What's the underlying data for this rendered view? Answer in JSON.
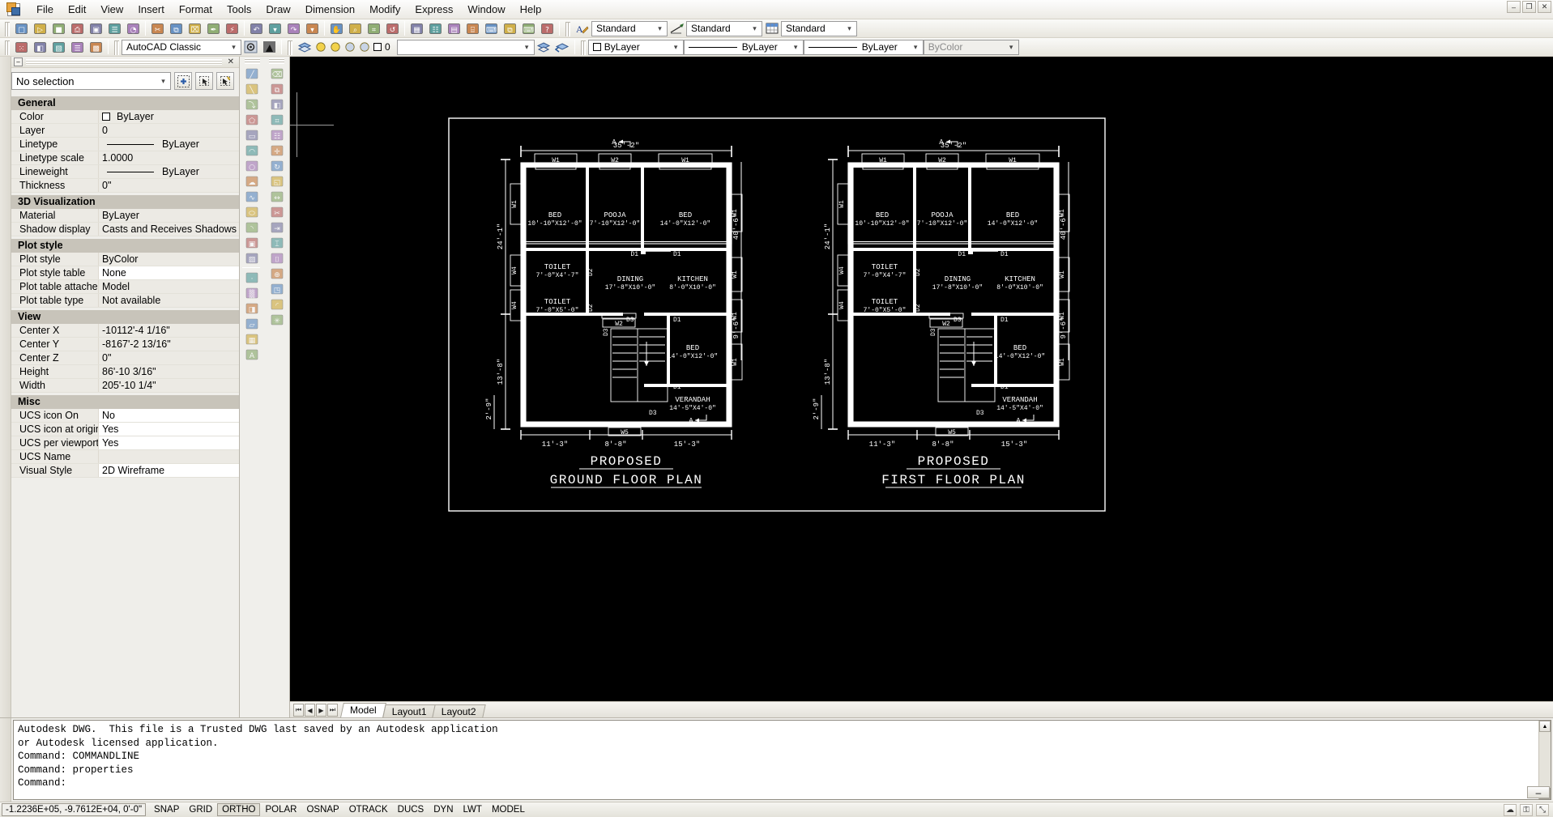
{
  "app": {
    "title": "AutoCAD Classic",
    "logo_icon": "autocad-logo-icon"
  },
  "menubar": {
    "items": [
      {
        "label": "File"
      },
      {
        "label": "Edit"
      },
      {
        "label": "View"
      },
      {
        "label": "Insert"
      },
      {
        "label": "Format"
      },
      {
        "label": "Tools"
      },
      {
        "label": "Draw"
      },
      {
        "label": "Dimension"
      },
      {
        "label": "Modify"
      },
      {
        "label": "Express"
      },
      {
        "label": "Window"
      },
      {
        "label": "Help"
      }
    ],
    "window_buttons": [
      {
        "name": "minimize-button",
        "glyph": "–"
      },
      {
        "name": "restore-button",
        "glyph": "❐"
      },
      {
        "name": "close-button",
        "glyph": "✕"
      }
    ]
  },
  "toolbar_row1": {
    "icons": [
      {
        "name": "new-icon",
        "glyph": "□"
      },
      {
        "name": "open-icon",
        "glyph": "▷"
      },
      {
        "name": "save-icon",
        "glyph": "■"
      },
      {
        "name": "plot-icon",
        "glyph": "⎙"
      },
      {
        "name": "plot-preview-icon",
        "glyph": "▣"
      },
      {
        "name": "publish-icon",
        "glyph": "☰"
      },
      {
        "name": "publish-to-web-icon",
        "glyph": "◔"
      },
      {
        "name": "cut-icon",
        "glyph": "✂"
      },
      {
        "name": "copy-icon",
        "glyph": "⧉"
      },
      {
        "name": "paste-icon",
        "glyph": "⌧"
      },
      {
        "name": "match-properties-icon",
        "glyph": "✒"
      },
      {
        "name": "block-editor-icon",
        "glyph": "⚡"
      },
      {
        "name": "undo-icon",
        "glyph": "↶"
      },
      {
        "name": "undo-dropdown-icon",
        "glyph": "▾"
      },
      {
        "name": "redo-icon",
        "glyph": "↷"
      },
      {
        "name": "redo-dropdown-icon",
        "glyph": "▾"
      },
      {
        "name": "pan-realtime-icon",
        "glyph": "✋"
      },
      {
        "name": "zoom-realtime-icon",
        "glyph": "⌕"
      },
      {
        "name": "zoom-window-icon",
        "glyph": "⌗"
      },
      {
        "name": "zoom-previous-icon",
        "glyph": "↺"
      },
      {
        "name": "properties-icon",
        "glyph": "▦"
      },
      {
        "name": "designcenter-icon",
        "glyph": "☷"
      },
      {
        "name": "tool-palettes-icon",
        "glyph": "▤"
      },
      {
        "name": "sheet-set-manager-icon",
        "glyph": "⌸"
      },
      {
        "name": "markup-set-manager-icon",
        "glyph": "⌨"
      },
      {
        "name": "external-references-icon",
        "glyph": "⧉"
      },
      {
        "name": "quickcalc-icon",
        "glyph": "⌨"
      },
      {
        "name": "help-icon",
        "glyph": "?"
      }
    ],
    "text_style": {
      "label": "Standard",
      "icon": "text-style-icon"
    },
    "dim_style": {
      "label": "Standard",
      "icon": "dimension-style-icon"
    },
    "table_style": {
      "label": "Standard",
      "icon": "table-style-icon"
    }
  },
  "toolbar_row2": {
    "icons": [
      {
        "name": "point-style-icon",
        "glyph": "⁙"
      },
      {
        "name": "layer-previous-icon",
        "glyph": "◧"
      },
      {
        "name": "layer-states-icon",
        "glyph": "▧"
      },
      {
        "name": "standards-icon",
        "glyph": "☰"
      },
      {
        "name": "layer-translator-icon",
        "glyph": "▩"
      }
    ],
    "workspace": {
      "label": "AutoCAD Classic"
    },
    "workspace_settings_icon": "workspace-settings-icon",
    "workspace_lock_icon": "workspace-lock-icon",
    "layer_properties_icon": "layer-properties-manager-icon",
    "layer_status_icons": [
      {
        "name": "layer-on-icon",
        "glyph": "○"
      },
      {
        "name": "layer-freeze-icon",
        "glyph": "●"
      },
      {
        "name": "layer-freeze-vp-icon",
        "glyph": "⚙"
      },
      {
        "name": "layer-lock-icon",
        "glyph": "⚿"
      }
    ],
    "current_layer": "0",
    "layer_color_swatch": "#ffffff",
    "make_object_layer_icon": "make-object-layer-current-icon",
    "layer_previous_icon": "layer-previous-icon",
    "color_control": {
      "label": "ByLayer",
      "swatch": "#ffffff"
    },
    "linetype_control": {
      "label": "ByLayer"
    },
    "lineweight_control": {
      "label": "ByLayer"
    },
    "plotstyle_control": {
      "label": "ByColor",
      "disabled": true
    }
  },
  "properties_palette": {
    "title_min_glyph": "–",
    "close_glyph": "✕",
    "selection": "No selection",
    "quick_select_icon": "quick-select-icon",
    "toggle_pickadd_icon": "toggle-value-pickadd-icon",
    "select_objects_icon": "select-objects-icon",
    "groups": [
      {
        "header": "General",
        "rows": [
          {
            "name": "Color",
            "value": "ByLayer",
            "swatch": "#ffffff",
            "editable": false
          },
          {
            "name": "Layer",
            "value": "0",
            "editable": false
          },
          {
            "name": "Linetype",
            "value": "ByLayer",
            "line": true,
            "editable": false
          },
          {
            "name": "Linetype scale",
            "value": "1.0000",
            "editable": false
          },
          {
            "name": "Lineweight",
            "value": "ByLayer",
            "line": true,
            "editable": false
          },
          {
            "name": "Thickness",
            "value": "0\"",
            "editable": false
          }
        ]
      },
      {
        "header": "3D Visualization",
        "rows": [
          {
            "name": "Material",
            "value": "ByLayer",
            "editable": false
          },
          {
            "name": "Shadow display",
            "value": "Casts and Receives Shadows",
            "editable": false
          }
        ]
      },
      {
        "header": "Plot style",
        "rows": [
          {
            "name": "Plot style",
            "value": "ByColor",
            "editable": false
          },
          {
            "name": "Plot style table",
            "value": "None",
            "editable": true
          },
          {
            "name": "Plot table attache...",
            "value": "Model",
            "editable": false
          },
          {
            "name": "Plot table type",
            "value": "Not available",
            "editable": false
          }
        ]
      },
      {
        "header": "View",
        "rows": [
          {
            "name": "Center X",
            "value": "-10112'-4 1/16\"",
            "editable": false
          },
          {
            "name": "Center Y",
            "value": "-8167'-2 13/16\"",
            "editable": false
          },
          {
            "name": "Center Z",
            "value": "0\"",
            "editable": false
          },
          {
            "name": "Height",
            "value": "86'-10 3/16\"",
            "editable": false
          },
          {
            "name": "Width",
            "value": "205'-10 1/4\"",
            "editable": false
          }
        ]
      },
      {
        "header": "Misc",
        "rows": [
          {
            "name": "UCS icon On",
            "value": "No",
            "editable": true
          },
          {
            "name": "UCS icon at origin",
            "value": "Yes",
            "editable": true
          },
          {
            "name": "UCS per viewport",
            "value": "Yes",
            "editable": true
          },
          {
            "name": "UCS Name",
            "value": "",
            "editable": false
          },
          {
            "name": "Visual Style",
            "value": "2D Wireframe",
            "editable": true
          }
        ]
      }
    ]
  },
  "draw_toolbar": {
    "icons": [
      {
        "name": "line-icon",
        "glyph": "╱"
      },
      {
        "name": "construction-line-icon",
        "glyph": "╲"
      },
      {
        "name": "polyline-icon",
        "glyph": "⤵"
      },
      {
        "name": "polygon-icon",
        "glyph": "⬠"
      },
      {
        "name": "rectangle-icon",
        "glyph": "▭"
      },
      {
        "name": "arc-icon",
        "glyph": "◠"
      },
      {
        "name": "circle-icon",
        "glyph": "○"
      },
      {
        "name": "revision-cloud-icon",
        "glyph": "☁"
      },
      {
        "name": "spline-icon",
        "glyph": "∿"
      },
      {
        "name": "ellipse-icon",
        "glyph": "⬭"
      },
      {
        "name": "ellipse-arc-icon",
        "glyph": "◝"
      },
      {
        "name": "insert-block-icon",
        "glyph": "▣"
      },
      {
        "name": "make-block-icon",
        "glyph": "▨"
      },
      {
        "name": "point-icon",
        "glyph": "·"
      },
      {
        "name": "hatch-icon",
        "glyph": "▒"
      },
      {
        "name": "gradient-icon",
        "glyph": "◨"
      },
      {
        "name": "region-icon",
        "glyph": "▱"
      },
      {
        "name": "table-icon",
        "glyph": "▦"
      },
      {
        "name": "multiline-text-icon",
        "glyph": "A"
      }
    ]
  },
  "modify_toolbar": {
    "icons": [
      {
        "name": "erase-icon",
        "glyph": "⌫"
      },
      {
        "name": "copy-object-icon",
        "glyph": "⧉"
      },
      {
        "name": "mirror-icon",
        "glyph": "◧"
      },
      {
        "name": "offset-icon",
        "glyph": "⌗"
      },
      {
        "name": "array-icon",
        "glyph": "☷"
      },
      {
        "name": "move-icon",
        "glyph": "✛"
      },
      {
        "name": "rotate-icon",
        "glyph": "↻"
      },
      {
        "name": "scale-icon",
        "glyph": "◱"
      },
      {
        "name": "stretch-icon",
        "glyph": "↔"
      },
      {
        "name": "trim-icon",
        "glyph": "✂"
      },
      {
        "name": "extend-icon",
        "glyph": "⇥"
      },
      {
        "name": "break-at-point-icon",
        "glyph": "⌶"
      },
      {
        "name": "break-icon",
        "glyph": "⌷"
      },
      {
        "name": "join-icon",
        "glyph": "⊕"
      },
      {
        "name": "chamfer-icon",
        "glyph": "◳"
      },
      {
        "name": "fillet-icon",
        "glyph": "◜"
      },
      {
        "name": "explode-icon",
        "glyph": "✳"
      }
    ]
  },
  "canvas": {
    "crosshair_icon": "crosshair-cursor-icon"
  },
  "layout_tabs": {
    "nav": [
      {
        "name": "first-layout-button",
        "glyph": "⏮"
      },
      {
        "name": "prev-layout-button",
        "glyph": "◀"
      },
      {
        "name": "next-layout-button",
        "glyph": "▶"
      },
      {
        "name": "last-layout-button",
        "glyph": "⏭"
      }
    ],
    "tabs": [
      {
        "label": "Model",
        "active": true
      },
      {
        "label": "Layout1",
        "active": false
      },
      {
        "label": "Layout2",
        "active": false
      }
    ]
  },
  "command_window": {
    "lines": [
      "Autodesk DWG.  This file is a Trusted DWG last saved by an Autodesk application",
      "or Autodesk licensed application.",
      "Command: COMMANDLINE",
      "Command: properties",
      "Command:"
    ],
    "minimize_glyph": "–",
    "scroll_up_glyph": "▲",
    "scroll_down_glyph": "▼"
  },
  "statusbar": {
    "coordinates": "-1.2236E+05, -9.7612E+04, 0'-0\"",
    "toggles": [
      {
        "label": "SNAP",
        "on": false
      },
      {
        "label": "GRID",
        "on": false
      },
      {
        "label": "ORTHO",
        "on": true
      },
      {
        "label": "POLAR",
        "on": false
      },
      {
        "label": "OSNAP",
        "on": false
      },
      {
        "label": "OTRACK",
        "on": false
      },
      {
        "label": "DUCS",
        "on": false
      },
      {
        "label": "DYN",
        "on": false
      },
      {
        "label": "LWT",
        "on": false
      },
      {
        "label": "MODEL",
        "on": false
      }
    ],
    "right_icons": [
      {
        "name": "communication-center-icon",
        "glyph": "☁"
      },
      {
        "name": "toolbar-lock-icon",
        "glyph": "⚿"
      },
      {
        "name": "clean-screen-icon",
        "glyph": "⤡"
      }
    ]
  },
  "drawing": {
    "sheet_border": true,
    "plans": [
      {
        "id": "ground-floor-plan",
        "title_line1": "PROPOSED",
        "title_line2": "GROUND FLOOR PLAN",
        "dim_top": "35'-2\"",
        "dim_left_upper": "24'-1\"",
        "dim_left_lower": "13'-8\"",
        "dim_left_bottom": "2'-9\"",
        "dim_right_upper": "40'-6\"",
        "dim_right_lower": "9'-6\"",
        "dim_bottom": [
          "11'-3\"",
          "8'-8\"",
          "15'-3\""
        ],
        "section_marks": [
          "A",
          "A"
        ],
        "rooms": [
          {
            "name": "BED",
            "size": "10'-10\"X12'-0\""
          },
          {
            "name": "POOJA",
            "size": "7'-10\"X12'-0\""
          },
          {
            "name": "BED",
            "size": "14'-0\"X12'-0\""
          },
          {
            "name": "TOILET",
            "size": "7'-0\"X4'-7\""
          },
          {
            "name": "TOILET",
            "size": "7'-0\"X5'-0\""
          },
          {
            "name": "DINING",
            "size": "17'-8\"X10'-0\""
          },
          {
            "name": "KITCHEN",
            "size": "8'-0\"X10'-0\""
          },
          {
            "name": "BED",
            "size": "14'-0\"X12'-0\""
          },
          {
            "name": "VERANDAH",
            "size": "14'-5\"X4'-0\""
          }
        ],
        "windows": [
          "W1",
          "W2",
          "W1",
          "W1",
          "W4",
          "W4",
          "W2",
          "W5",
          "W1",
          "W1",
          "W1",
          "W1"
        ],
        "doors": [
          "D1",
          "D1",
          "D1",
          "D2",
          "D2",
          "D3",
          "D3",
          "D1",
          "D1",
          "D3"
        ]
      },
      {
        "id": "first-floor-plan",
        "title_line1": "PROPOSED",
        "title_line2": "FIRST FLOOR PLAN",
        "dim_top": "35'-2\"",
        "dim_left_upper": "24'-1\"",
        "dim_left_lower": "13'-8\"",
        "dim_left_bottom": "2'-9\"",
        "dim_right_upper": "40'-6\"",
        "dim_right_lower": "9'-6\"",
        "dim_bottom": [
          "11'-3\"",
          "8'-8\"",
          "15'-3\""
        ],
        "section_marks": [
          "A",
          "A"
        ],
        "rooms": [
          {
            "name": "BED",
            "size": "10'-10\"X12'-0\""
          },
          {
            "name": "POOJA",
            "size": "7'-10\"X12'-0\""
          },
          {
            "name": "BED",
            "size": "14'-0\"X12'-0\""
          },
          {
            "name": "TOILET",
            "size": "7'-0\"X4'-7\""
          },
          {
            "name": "TOILET",
            "size": "7'-0\"X5'-0\""
          },
          {
            "name": "DINING",
            "size": "17'-8\"X10'-0\""
          },
          {
            "name": "KITCHEN",
            "size": "8'-0\"X10'-0\""
          },
          {
            "name": "BED",
            "size": "14'-0\"X12'-0\""
          },
          {
            "name": "VERANDAH",
            "size": "14'-5\"X4'-0\""
          }
        ],
        "windows": [
          "W1",
          "W2",
          "W1",
          "W1",
          "W4",
          "W4",
          "W2",
          "W5",
          "W1",
          "W1",
          "W1",
          "W1"
        ],
        "doors": [
          "D1",
          "D1",
          "D1",
          "D2",
          "D2",
          "D3",
          "D3",
          "D1",
          "D1",
          "D3"
        ]
      }
    ]
  }
}
